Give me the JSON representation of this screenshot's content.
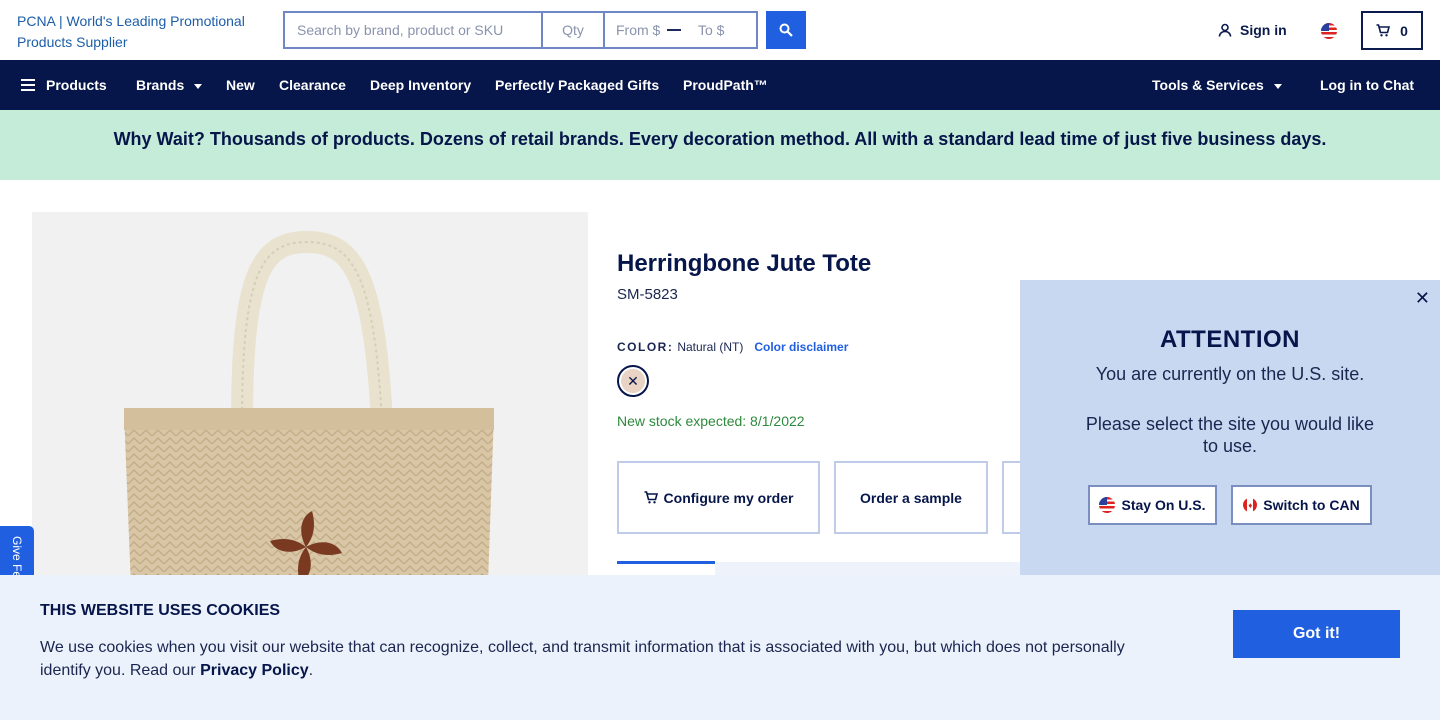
{
  "header": {
    "logo_alt": "PCNA | World's Leading Promotional Products Supplier",
    "search_placeholder": "Search by brand, product or SKU",
    "qty_placeholder": "Qty",
    "price_from_placeholder": "From $",
    "price_to_placeholder": "To $",
    "signin_label": "Sign in",
    "cart_count": "0"
  },
  "nav": {
    "items": [
      "Products",
      "Brands",
      "New",
      "Clearance",
      "Deep Inventory",
      "Perfectly Packaged Gifts",
      "ProudPath™"
    ],
    "tools": "Tools & Services",
    "chat": "Log in to Chat"
  },
  "promo": "Why Wait? Thousands of products. Dozens of retail brands. Every decoration method. All with a standard lead time of just five business days.",
  "product": {
    "title": "Herringbone Jute Tote",
    "sku": "SM-5823",
    "color_label": "COLOR:",
    "color_value": "Natural (NT)",
    "color_disclaimer": "Color disclaimer",
    "swatch_color": "#e8d3c4",
    "stock": "New stock expected: 8/1/2022",
    "configure_label": "Configure my order",
    "sample_label": "Order a sample"
  },
  "feedback_label": "Give Feedback",
  "attention": {
    "close": "✕",
    "title": "ATTENTION",
    "line1": "You are currently on the U.S. site.",
    "line2": "Please select the site you would like to use.",
    "stay_label": "Stay On U.S.",
    "switch_label": "Switch to CAN"
  },
  "cookie": {
    "title": "THIS WEBSITE USES COOKIES",
    "text": "We use cookies when you visit our website that can recognize, collect, and transmit information that is associated with you, but which does not personally identify you. Read our",
    "link": "Privacy Policy",
    "period": ".",
    "button": "Got it!"
  },
  "colors": {
    "navy": "#06154a",
    "accent_blue": "#1f5fe0",
    "promo_green": "#c4ecd8",
    "stock_green": "#2d8a3c"
  }
}
